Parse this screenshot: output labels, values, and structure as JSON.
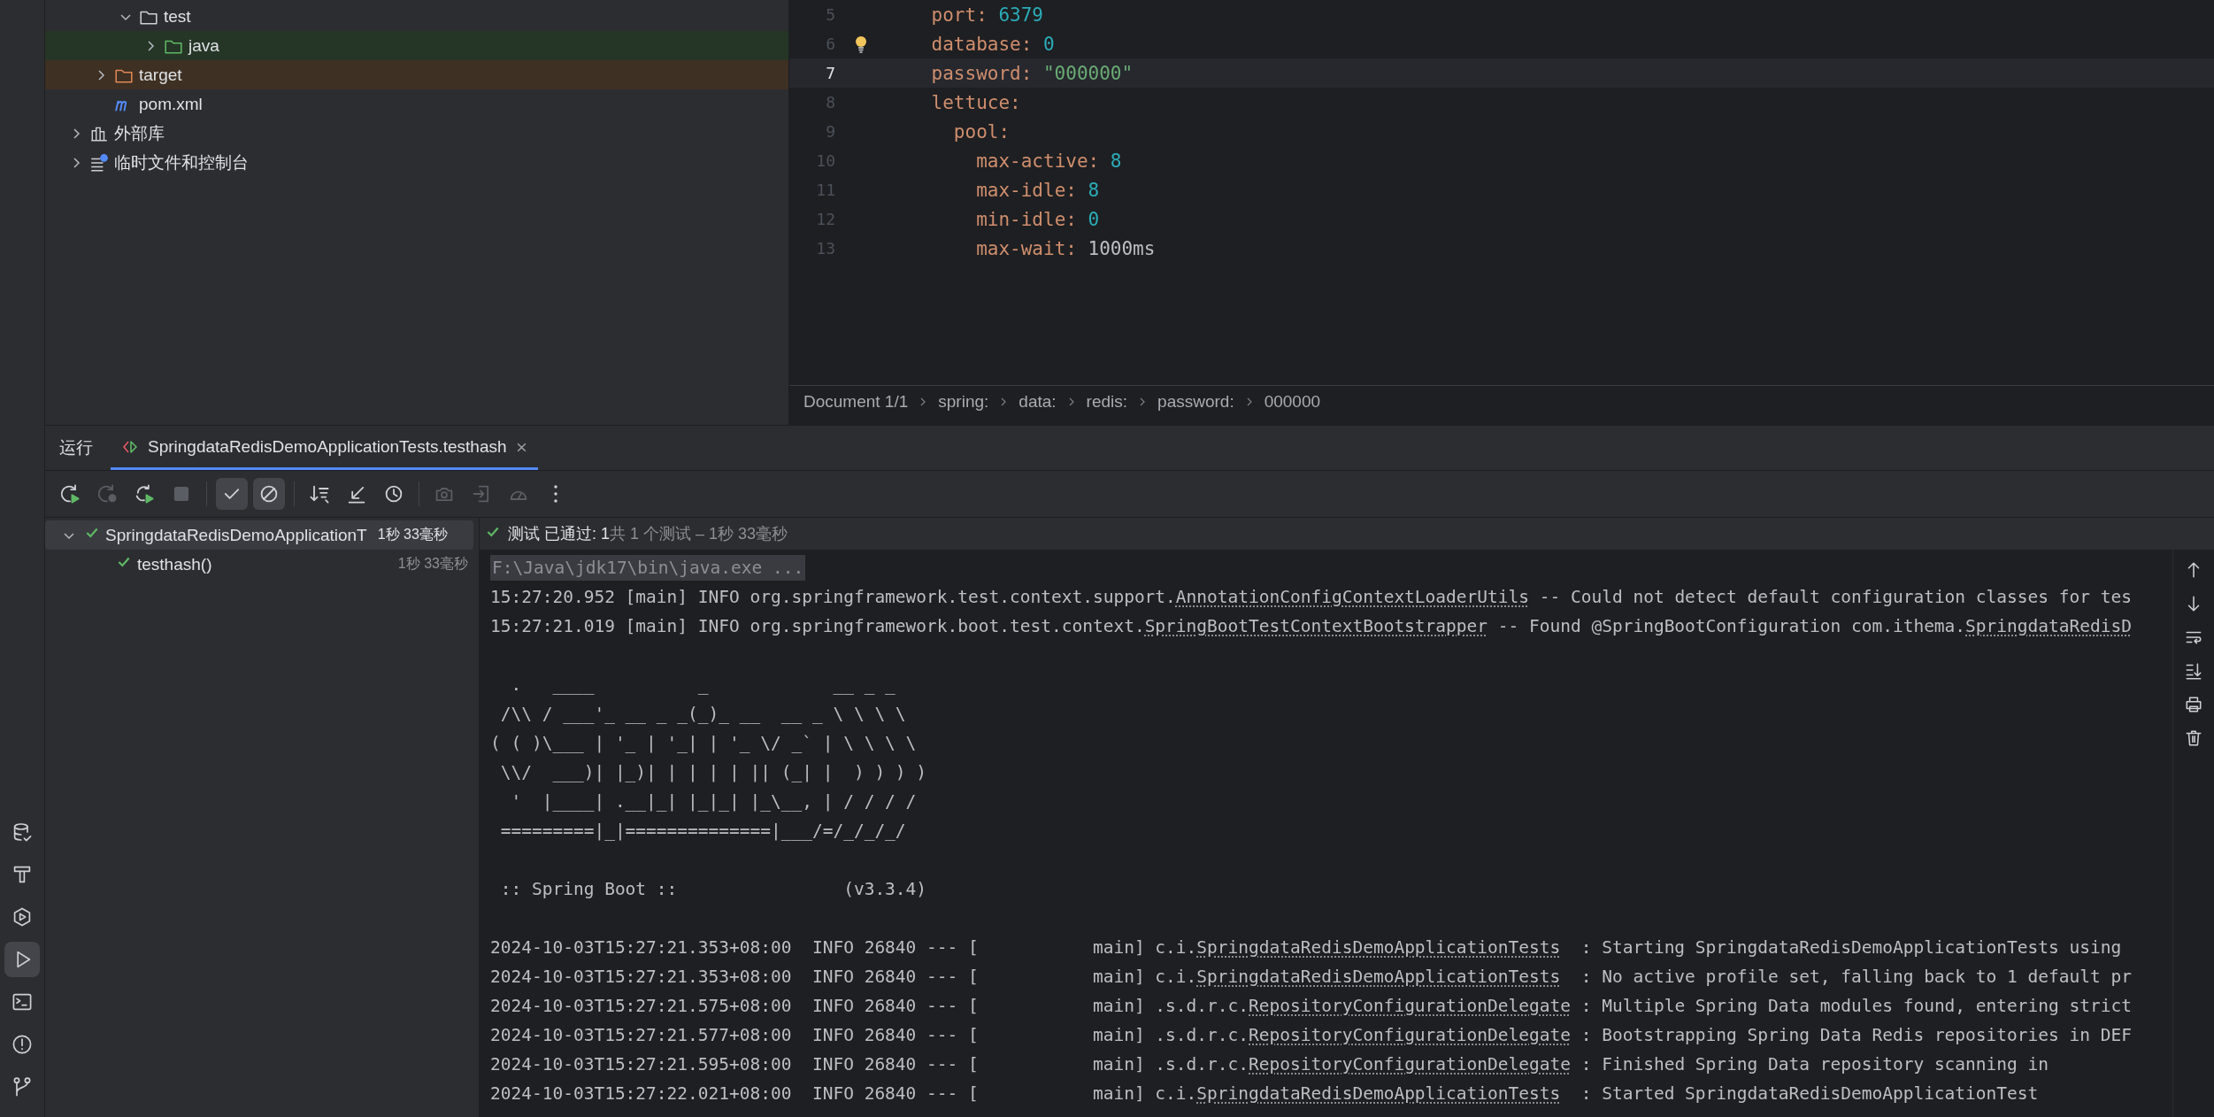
{
  "project_tree": {
    "items": [
      {
        "children": [
          {
            "children": [
              {
                "label": "test",
                "kind": "folder",
                "expanded": true,
                "children": [
                  {
                    "label": "java",
                    "kind": "test-folder",
                    "expanded": false
                  }
                ]
              }
            ]
          },
          {
            "label": "target",
            "kind": "excluded-folder",
            "expanded": false
          },
          {
            "label": "pom.xml",
            "kind": "maven"
          }
        ]
      },
      {
        "label": "外部库",
        "kind": "library",
        "expanded": false
      },
      {
        "label": "临时文件和控制台",
        "kind": "scratches",
        "expanded": false
      }
    ]
  },
  "editor": {
    "lines": [
      {
        "number": "5",
        "key": "    port:",
        "value": "6379",
        "kind": "number",
        "current": false,
        "bulb": false
      },
      {
        "number": "6",
        "key": "    database:",
        "value": "0",
        "kind": "number",
        "current": false,
        "bulb": true
      },
      {
        "number": "7",
        "key": "    password:",
        "value": "\"000000\"",
        "kind": "string",
        "current": true,
        "bulb": false
      },
      {
        "number": "8",
        "key": "    lettuce:",
        "current": false,
        "bulb": false
      },
      {
        "number": "9",
        "key": "      pool:",
        "current": false,
        "bulb": false
      },
      {
        "number": "10",
        "key": "        max-active:",
        "value": "8",
        "kind": "number",
        "current": false,
        "bulb": false
      },
      {
        "number": "11",
        "key": "        max-idle:",
        "value": "8",
        "kind": "number",
        "current": false,
        "bulb": false
      },
      {
        "number": "12",
        "key": "        min-idle:",
        "value": "0",
        "kind": "number",
        "current": false,
        "bulb": false
      },
      {
        "number": "13",
        "key": "        max-wait:",
        "value": "1000ms",
        "kind": "plain",
        "current": false,
        "bulb": false
      }
    ],
    "breadcrumb": [
      "Document 1/1",
      "spring:",
      "data:",
      "redis:",
      "password:",
      "000000"
    ]
  },
  "run_panel": {
    "title": "运行",
    "tabs": [
      {
        "label": "SpringdataRedisDemoApplicationTests.testhash",
        "selected": true
      }
    ],
    "toolbar": [
      {
        "kind": "rerun",
        "disabled": false,
        "on": false
      },
      {
        "kind": "rerun-failed",
        "disabled": true,
        "on": false
      },
      {
        "kind": "auto-rerun",
        "disabled": false,
        "on": false
      },
      {
        "kind": "stop",
        "disabled": true,
        "on": false
      },
      {
        "kind": "show-passed",
        "disabled": false,
        "on": true
      },
      {
        "kind": "show-ignored",
        "disabled": false,
        "on": true
      },
      {
        "kind": "sort",
        "disabled": false,
        "on": false
      },
      {
        "kind": "import",
        "disabled": false,
        "on": false
      },
      {
        "kind": "history",
        "disabled": false,
        "on": false
      },
      {
        "kind": "screenshot",
        "disabled": true,
        "on": false
      },
      {
        "kind": "export",
        "disabled": true,
        "on": false
      },
      {
        "kind": "coverage",
        "disabled": true,
        "on": false
      },
      {
        "kind": "more",
        "disabled": false,
        "on": false
      }
    ],
    "tests": [
      {
        "label": "SpringdataRedisDemoApplicationT",
        "time": "1秒 33毫秒",
        "passed": true,
        "expanded": true,
        "selected": true,
        "children": [
          {
            "label": "testhash()",
            "time": "1秒 33毫秒",
            "passed": true,
            "selected": false
          }
        ]
      }
    ],
    "status": {
      "passed": true,
      "summary": "测试 已通过: 1",
      "detail": "共 1 个测试 – 1秒 33毫秒"
    },
    "console": [
      {
        "kind": "command",
        "text": "F:\\Java\\jdk17\\bin\\java.exe ..."
      },
      {
        "kind": "log",
        "prefix": "15:27:20.952 [main] INFO org.springframework.test.context.support.",
        "link": "AnnotationConfigContextLoaderUtils",
        "suffix": " -- Could not detect default configuration classes for tes"
      },
      {
        "kind": "log",
        "prefix": "15:27:21.019 [main] INFO org.springframework.boot.test.context.",
        "link": "SpringBootTestContextBootstrapper",
        "suffix": " -- Found @SpringBootConfiguration com.ithema.",
        "link2": "SpringdataRedisD"
      },
      {
        "kind": "blank"
      },
      {
        "kind": "text",
        "text": "  .   ____          _            __ _ _"
      },
      {
        "kind": "text",
        "text": " /\\\\ / ___'_ __ _ _(_)_ __  __ _ \\ \\ \\ \\"
      },
      {
        "kind": "text",
        "text": "( ( )\\___ | '_ | '_| | '_ \\/ _` | \\ \\ \\ \\"
      },
      {
        "kind": "text",
        "text": " \\\\/  ___)| |_)| | | | | || (_| |  ) ) ) )"
      },
      {
        "kind": "text",
        "text": "  '  |____| .__|_| |_|_| |_\\__, | / / / /"
      },
      {
        "kind": "text",
        "text": " =========|_|==============|___/=/_/_/_/"
      },
      {
        "kind": "blank"
      },
      {
        "kind": "text",
        "text": " :: Spring Boot ::                (v3.3.4)"
      },
      {
        "kind": "blank"
      },
      {
        "kind": "log",
        "prefix": "2024-10-03T15:27:21.353+08:00  INFO 26840 --- [           main] c.i.",
        "link": "SpringdataRedisDemoApplicationTests",
        "suffix": "  : Starting SpringdataRedisDemoApplicationTests using"
      },
      {
        "kind": "log",
        "prefix": "2024-10-03T15:27:21.353+08:00  INFO 26840 --- [           main] c.i.",
        "link": "SpringdataRedisDemoApplicationTests",
        "suffix": "  : No active profile set, falling back to 1 default pr"
      },
      {
        "kind": "log",
        "prefix": "2024-10-03T15:27:21.575+08:00  INFO 26840 --- [           main] .s.d.r.c.",
        "link": "RepositoryConfigurationDelegate",
        "suffix": " : Multiple Spring Data modules found, entering strict"
      },
      {
        "kind": "log",
        "prefix": "2024-10-03T15:27:21.577+08:00  INFO 26840 --- [           main] .s.d.r.c.",
        "link": "RepositoryConfigurationDelegate",
        "suffix": " : Bootstrapping Spring Data Redis repositories in DEF"
      },
      {
        "kind": "log",
        "prefix": "2024-10-03T15:27:21.595+08:00  INFO 26840 --- [           main] .s.d.r.c.",
        "link": "RepositoryConfigurationDelegate",
        "suffix": " : Finished Spring Data repository scanning in"
      },
      {
        "kind": "log",
        "prefix": "2024-10-03T15:27:22.021+08:00  INFO 26840 --- [           main] c.i.",
        "link": "SpringdataRedisDemoApplicationTests",
        "suffix": "  : Started SpringdataRedisDemoApplicationTest"
      }
    ],
    "console_tools": [
      {
        "kind": "up"
      },
      {
        "kind": "down"
      },
      {
        "kind": "wrap"
      },
      {
        "kind": "scroll-end"
      },
      {
        "kind": "print"
      },
      {
        "kind": "delete"
      }
    ]
  },
  "tool_strip": [
    {
      "kind": "database",
      "selected": false
    },
    {
      "kind": "build",
      "selected": false
    },
    {
      "kind": "services",
      "selected": false
    },
    {
      "kind": "run",
      "selected": true
    },
    {
      "kind": "terminal",
      "selected": false
    },
    {
      "kind": "problems",
      "selected": false
    },
    {
      "kind": "git",
      "selected": false
    }
  ]
}
